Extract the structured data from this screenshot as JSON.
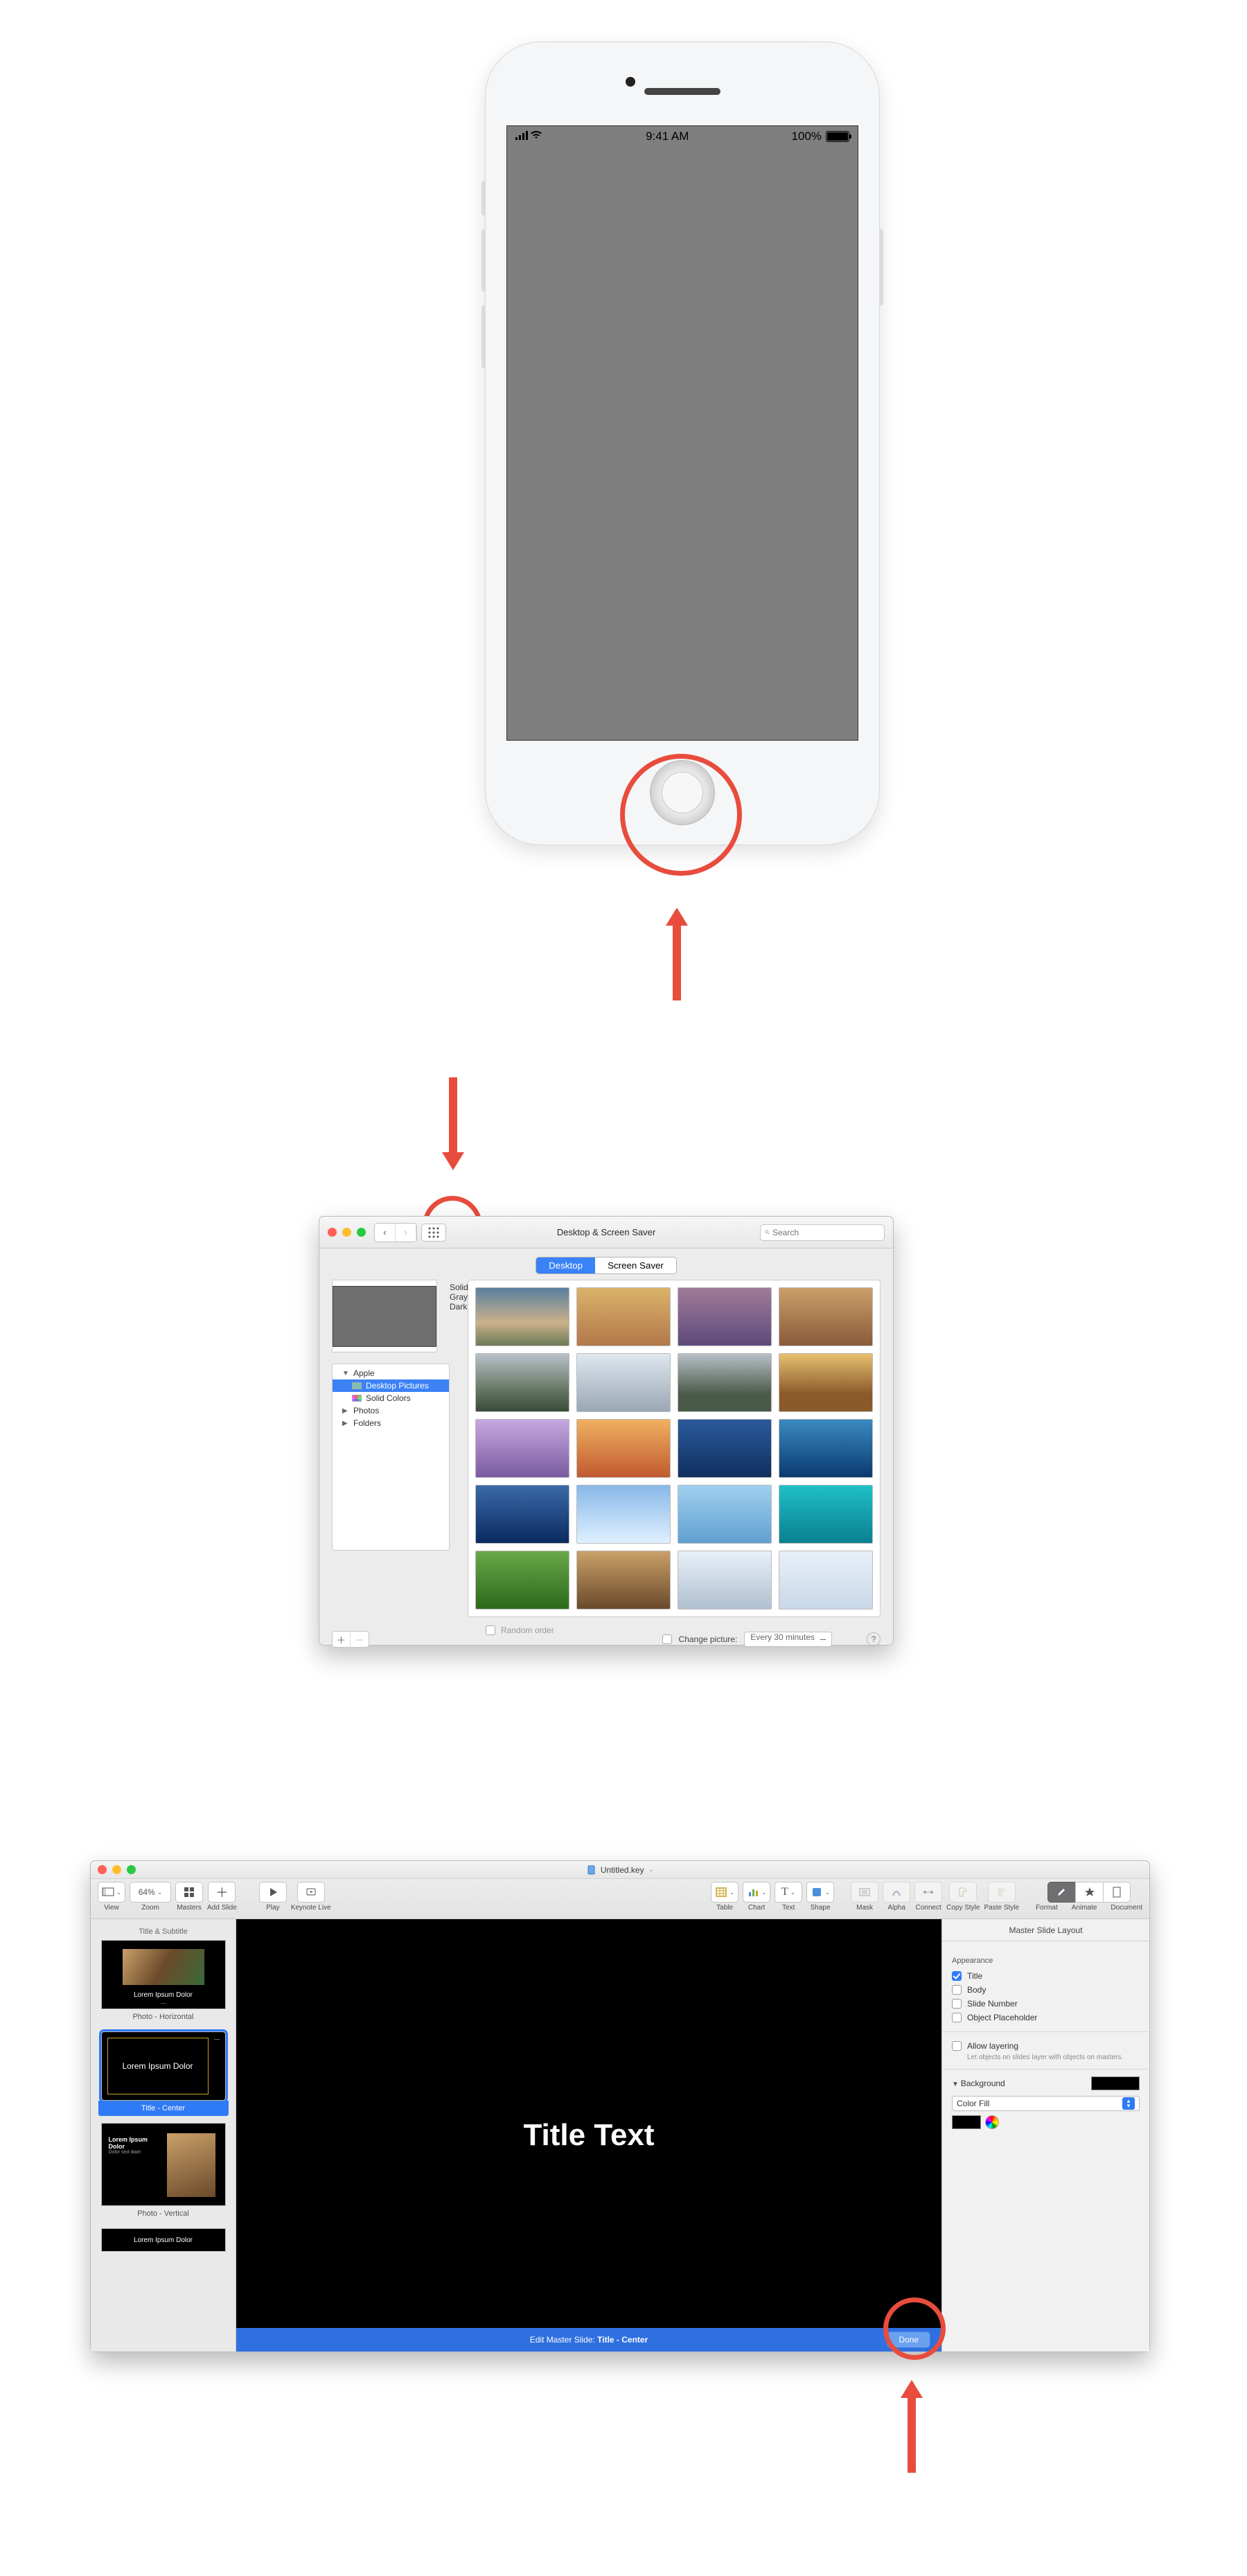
{
  "iphone": {
    "status_time": "9:41 AM",
    "battery_pct": "100%"
  },
  "syspref": {
    "window_title": "Desktop & Screen Saver",
    "search_placeholder": "Search",
    "tabs": {
      "desktop": "Desktop",
      "screensaver": "Screen Saver"
    },
    "current_wallpaper_name": "Solid Gray Dark",
    "sources": {
      "apple": "Apple",
      "desktop_pictures": "Desktop Pictures",
      "solid_colors": "Solid Colors",
      "photos": "Photos",
      "folders": "Folders"
    },
    "change_picture_label": "Change picture:",
    "change_interval": "Every 30 minutes",
    "random_order_label": "Random order",
    "thumb_styles": [
      "linear-gradient(#5a7fa0,#cbb18a 60%,#6b7a58)",
      "linear-gradient(#dbb36a,#b2784a)",
      "linear-gradient(#a07a9a,#5e4a7a)",
      "linear-gradient(#caa06a,#8a5a3a)",
      "linear-gradient(#b8c0c8,#6a7a68 60%,#3a4a38)",
      "linear-gradient(#dfe7ef,#9aa7b4)",
      "linear-gradient(#b8c0c8,#4a5a48 70%)",
      "linear-gradient(#e8c070,#8a5a2a 70%)",
      "linear-gradient(#c8a8e0,#7a5aa0)",
      "linear-gradient(#f0b060,#c05a30)",
      "linear-gradient(#2a5a9a,#103060)",
      "linear-gradient(#3a8ac0,#0a3a70)",
      "linear-gradient(#3a6aa8,#0a2a60)",
      "linear-gradient(#88b8e8,#dff0ff)",
      "linear-gradient(#a0d0f0,#60a0d0)",
      "linear-gradient(#20c0c8,#0a8090)",
      "linear-gradient(#6aa84a,#2a6a1a)",
      "linear-gradient(#caa06a,#6a4a2a)",
      "linear-gradient(#e8f0f8,#b0c0d0)",
      "linear-gradient(#e8f0f8,#c8d8e8)"
    ]
  },
  "keynote": {
    "doc_title": "Untitled.key",
    "toolbar": {
      "view": "View",
      "zoom": "Zoom",
      "zoom_value": "64%",
      "masters": "Masters",
      "add_slide": "Add Slide",
      "play": "Play",
      "keynote_live": "Keynote Live",
      "table": "Table",
      "chart": "Chart",
      "text": "Text",
      "shape": "Shape",
      "mask": "Mask",
      "alpha": "Alpha",
      "connect": "Connect",
      "copy_style": "Copy Style",
      "paste_style": "Paste Style",
      "format": "Format",
      "animate": "Animate",
      "document": "Document"
    },
    "navigator": {
      "m1_label": "Title & Subtitle",
      "m1_thumb_caption": "Lorem Ipsum Dolor",
      "m2_label": "Photo - Horizontal",
      "m3_thumb_text": "Lorem Ipsum Dolor",
      "m3_label": "Title - Center",
      "m4_thumb_title": "Lorem Ipsum Dolor",
      "m4_thumb_sub": "Dolor sed diam",
      "m4_label": "Photo - Vertical",
      "m5_thumb_text": "Lorem Ipsum Dolor"
    },
    "canvas_title": "Title Text",
    "editbar_prefix": "Edit Master Slide: ",
    "editbar_name": "Title - Center",
    "editbar_done": "Done",
    "inspector": {
      "header": "Master Slide Layout",
      "appearance": "Appearance",
      "title": "Title",
      "body": "Body",
      "slide_number": "Slide Number",
      "object_placeholder": "Object Placeholder",
      "allow_layering": "Allow layering",
      "allow_layering_hint": "Let objects on slides layer with objects on masters.",
      "background": "Background",
      "fill_type": "Color Fill"
    }
  }
}
